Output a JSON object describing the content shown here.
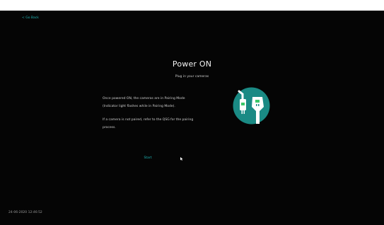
{
  "nav": {
    "back_label": "< Go Back"
  },
  "main": {
    "title": "Power ON",
    "subtitle": "Plug in your cameras",
    "description_line1": "Once powered ON, the cameras are in Pairing Mode",
    "description_line2": "(Indicator light flashes while in Pairing Mode).",
    "hint_line1": "If a camera is not paired, refer to the QSG for the pairing",
    "hint_line2": "process.",
    "start_label": "Start"
  },
  "footer": {
    "timestamp": "24-06-2020 12:46:52"
  },
  "illustration": {
    "icon": "power-plug-icon",
    "circle_color": "#1a8a84",
    "plug_color": "#ffffff",
    "indicator_color": "#3cc86a"
  },
  "theme": {
    "background": "#050505",
    "accent": "#1fb6b6",
    "text": "#f2f2f2"
  }
}
